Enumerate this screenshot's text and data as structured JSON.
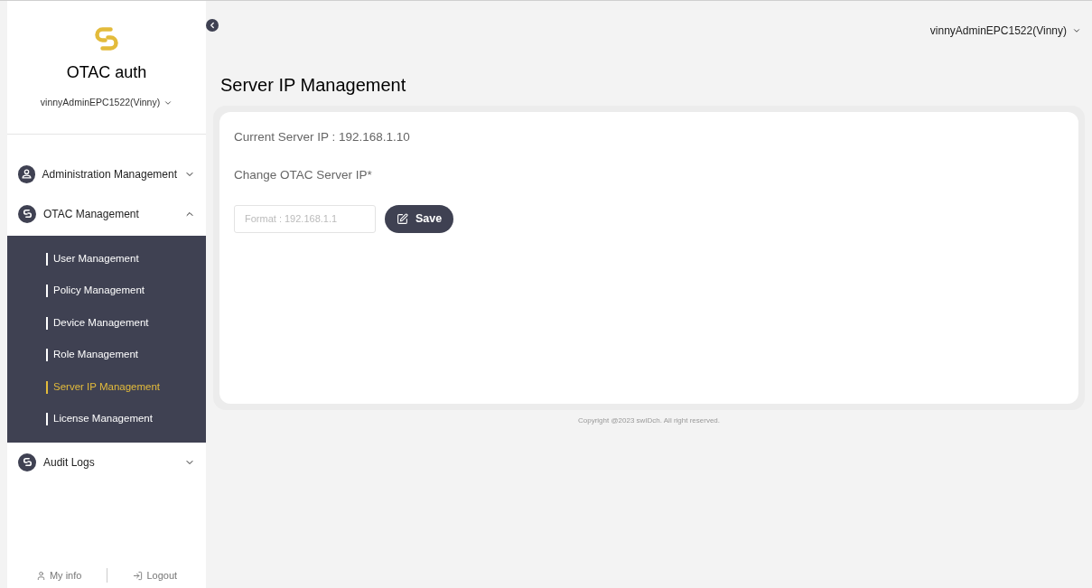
{
  "sidebar": {
    "brand": "OTAC auth",
    "user": "vinnyAdminEPC1522(Vinny)",
    "menu": [
      {
        "label": "Administration Management",
        "kind": "person",
        "expanded": false
      },
      {
        "label": "OTAC Management",
        "kind": "link",
        "expanded": true,
        "children": [
          {
            "label": "User Management",
            "selected": false
          },
          {
            "label": "Policy Management",
            "selected": false
          },
          {
            "label": "Device Management",
            "selected": false
          },
          {
            "label": "Role Management",
            "selected": false
          },
          {
            "label": "Server IP Management",
            "selected": true
          },
          {
            "label": "License Management",
            "selected": false
          }
        ]
      },
      {
        "label": "Audit Logs",
        "kind": "link",
        "expanded": false
      }
    ],
    "footer": {
      "my_info": "My info",
      "logout": "Logout"
    }
  },
  "header": {
    "user": "vinnyAdminEPC1522(Vinny)"
  },
  "page": {
    "title": "Server IP Management",
    "current_ip": "Current Server IP : 192.168.1.10",
    "change_label": "Change OTAC Server IP*",
    "input": {
      "placeholder": "Format : 192.168.1.1"
    },
    "save": "Save"
  },
  "copyright": "Copyright @2023 swIDch. All right reserved."
}
